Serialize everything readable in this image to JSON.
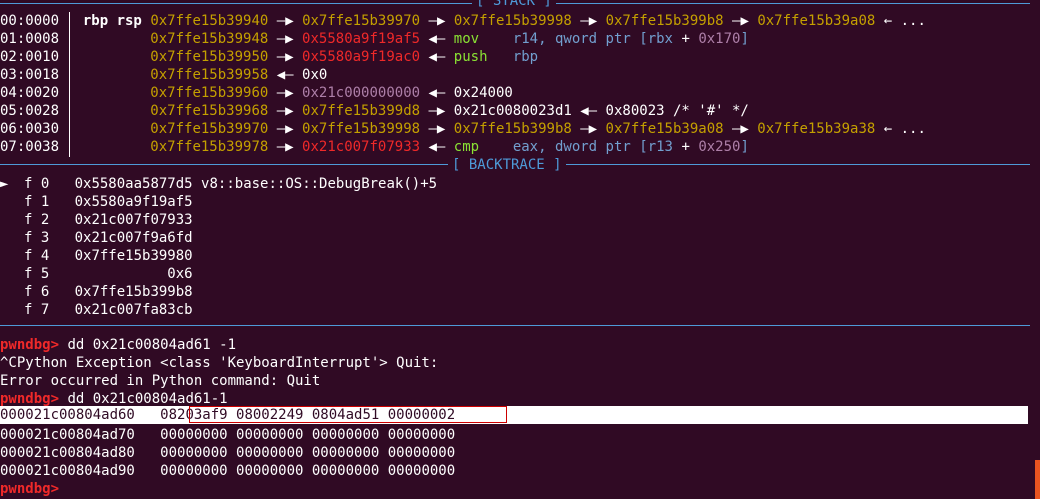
{
  "stack_header": "[ STACK ]",
  "backtrace_header": "[ BACKTRACE ]",
  "stack": [
    {
      "off": "00:0000",
      "regs": "rbp rsp",
      "a": "0x7ffe15b39940",
      "b": "0x7ffe15b39970",
      "c": "0x7ffe15b39998",
      "d": "0x7ffe15b399b8",
      "e": "0x7ffe15b39a08",
      "tail": "← ..."
    },
    {
      "off": "01:0008",
      "a": "0x7ffe15b39948",
      "b": "0x5580a9f19af5",
      "ins": "mov",
      "op1": "r14,",
      "op2": "qword ptr",
      "br_l": "[",
      "reg": "rbx",
      "plus": "+",
      "imm": "0x170",
      "br_r": "]"
    },
    {
      "off": "02:0010",
      "a": "0x7ffe15b39950",
      "b": "0x5580a9f19ac0",
      "ins": "push",
      "op1": "rbp"
    },
    {
      "off": "03:0018",
      "a": "0x7ffe15b39958",
      "val": "0x0"
    },
    {
      "off": "04:0020",
      "a": "0x7ffe15b39960",
      "b": "0x21c000000000",
      "val": "0x24000"
    },
    {
      "off": "05:0028",
      "a": "0x7ffe15b39968",
      "b": "0x7ffe15b399d8",
      "c": "0x21c0080023d1",
      "val": "0x80023",
      "comment": "/* '#' */"
    },
    {
      "off": "06:0030",
      "a": "0x7ffe15b39970",
      "b": "0x7ffe15b39998",
      "c": "0x7ffe15b399b8",
      "d": "0x7ffe15b39a08",
      "e": "0x7ffe15b39a38",
      "tail": "← ..."
    },
    {
      "off": "07:0038",
      "a": "0x7ffe15b39978",
      "b": "0x21c007f07933",
      "ins": "cmp",
      "op1": "eax,",
      "op2": "dword ptr",
      "br_l": "[",
      "reg": "r13",
      "plus": "+",
      "imm": "0x250",
      "br_r": "]"
    }
  ],
  "arrow_r": "—▶",
  "arrow_l": "◀—",
  "backtrace": [
    {
      "marker": "►",
      "frame": "f 0",
      "addr": "0x5580aa5877d5",
      "sym": "v8::base::OS::DebugBreak()+5"
    },
    {
      "marker": "",
      "frame": "f 1",
      "addr": "0x5580a9f19af5",
      "sym": ""
    },
    {
      "marker": "",
      "frame": "f 2",
      "addr": "0x21c007f07933",
      "sym": ""
    },
    {
      "marker": "",
      "frame": "f 3",
      "addr": "0x21c007f9a6fd",
      "sym": ""
    },
    {
      "marker": "",
      "frame": "f 4",
      "addr": "0x7ffe15b39980",
      "sym": ""
    },
    {
      "marker": "",
      "frame": "f 5",
      "addr": "           0x6",
      "sym": ""
    },
    {
      "marker": "",
      "frame": "f 6",
      "addr": "0x7ffe15b399b8",
      "sym": ""
    },
    {
      "marker": "",
      "frame": "f 7",
      "addr": "0x21c007fa83cb",
      "sym": ""
    }
  ],
  "console": {
    "prompt": "pwndbg>",
    "cmd1": " dd 0x21c00804ad61 -1",
    "line2": "^CPython Exception <class 'KeyboardInterrupt'> Quit:",
    "line3": "Error occurred in Python command: Quit",
    "cmd2": " dd 0x21c00804ad61-1",
    "dump": [
      {
        "addr": "000021c00804ad60",
        "words": "08203af9 08002249 0804ad51 00000002"
      },
      {
        "addr": "000021c00804ad70",
        "words": "00000000 00000000 00000000 00000000"
      },
      {
        "addr": "000021c00804ad80",
        "words": "00000000 00000000 00000000 00000000"
      },
      {
        "addr": "000021c00804ad90",
        "words": "00000000 00000000 00000000 00000000"
      }
    ]
  },
  "colors": {
    "bg": "#300a24",
    "yellow": "#c4a000",
    "red": "#ef2929",
    "green": "#8ae234",
    "blue": "#729fcf",
    "purple": "#ad7fa8",
    "rule": "#4e9ad8"
  }
}
